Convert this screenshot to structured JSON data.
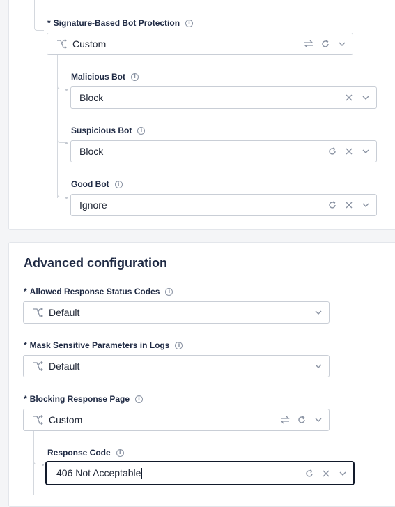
{
  "bot_section": {
    "signature": {
      "required": "*",
      "label": "Signature-Based Bot Protection",
      "value": "Custom"
    },
    "malicious": {
      "label": "Malicious Bot",
      "value": "Block"
    },
    "suspicious": {
      "label": "Suspicious Bot",
      "value": "Block"
    },
    "good": {
      "label": "Good Bot",
      "value": "Ignore"
    }
  },
  "advanced": {
    "title": "Advanced configuration",
    "status_codes": {
      "required": "*",
      "label": "Allowed Response Status Codes",
      "value": "Default"
    },
    "mask_params": {
      "required": "*",
      "label": "Mask Sensitive Parameters in Logs",
      "value": "Default"
    },
    "blocking_page": {
      "required": "*",
      "label": "Blocking Response Page",
      "value": "Custom"
    },
    "response_code": {
      "label": "Response Code",
      "value": "406 Not Acceptable"
    }
  },
  "icons": {
    "info": "i",
    "branch": "branch-icon",
    "swap": "swap-icon",
    "reset": "reset-icon",
    "clear": "×",
    "dropdown": "chevron-down-icon"
  },
  "colors": {
    "border": "#c9ced6",
    "focus_border": "#121a2b",
    "text": "#1d2433",
    "icon": "#8a93a3"
  }
}
